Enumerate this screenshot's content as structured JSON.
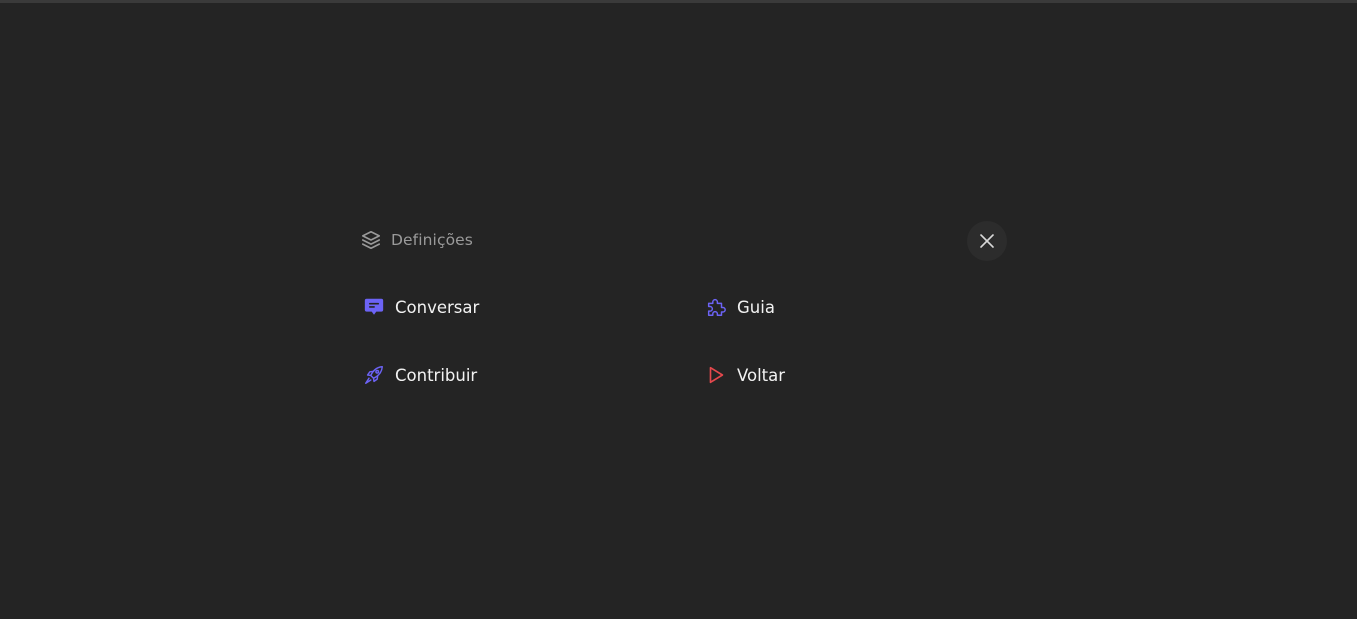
{
  "header": {
    "title": "Definições",
    "title_icon": "layers-icon",
    "close_icon": "close-icon"
  },
  "menu": {
    "items": [
      {
        "label": "Conversar",
        "icon": "chat-bubble-icon",
        "color": "#6c63f5"
      },
      {
        "label": "Guia",
        "icon": "puzzle-icon",
        "color": "#6c63f5"
      },
      {
        "label": "Contribuir",
        "icon": "rocket-icon",
        "color": "#6c63f5"
      },
      {
        "label": "Voltar",
        "icon": "play-icon",
        "color": "#e5484d"
      }
    ]
  },
  "colors": {
    "background": "#242424",
    "accent": "#6c63f5",
    "danger": "#e5484d",
    "muted_text": "#9a9a9a",
    "text": "#f2f2f2"
  }
}
